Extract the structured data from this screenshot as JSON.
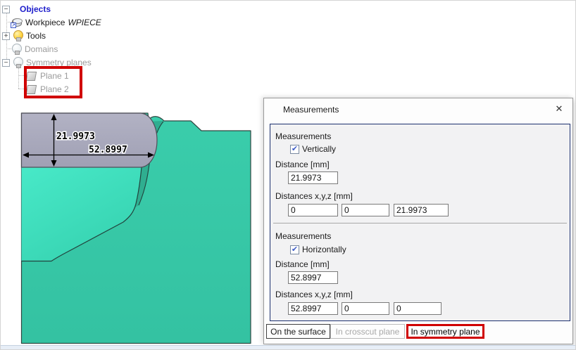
{
  "tree": {
    "expanded_glyph": "−",
    "collapsed_glyph": "+",
    "items": [
      {
        "label": "Objects"
      },
      {
        "label": "Workpiece",
        "name": "WPIECE"
      },
      {
        "label": "Tools"
      },
      {
        "label": "Domains"
      },
      {
        "label": "Symmetry planes"
      },
      {
        "label": "Plane 1"
      },
      {
        "label": "Plane 2"
      }
    ]
  },
  "viewport": {
    "vertical_distance": "21.9973",
    "horizontal_distance": "52.8997"
  },
  "dialog": {
    "title": "Measurements",
    "close_glyph": "✕",
    "sections": [
      {
        "heading": "Measurements",
        "checkbox_label": "Vertically",
        "checkbox_checked": true,
        "distance_label": "Distance [mm]",
        "distance_value": "21.9973",
        "distances_label": "Distances x,y,z [mm]",
        "distances_values": [
          "0",
          "0",
          "21.9973"
        ]
      },
      {
        "heading": "Measurements",
        "checkbox_label": "Horizontally",
        "checkbox_checked": true,
        "distance_label": "Distance [mm]",
        "distance_value": "52.8997",
        "distances_label": "Distances x,y,z [mm]",
        "distances_values": [
          "52.8997",
          "0",
          "0"
        ]
      }
    ],
    "tabs": [
      {
        "label": "On the surface",
        "state": "enabled"
      },
      {
        "label": "In crosscut plane",
        "state": "disabled"
      },
      {
        "label": "In symmetry plane",
        "state": "active-highlighted"
      }
    ]
  },
  "icons": {
    "check": "✔"
  },
  "colors": {
    "workpiece_main": "#36c5a5",
    "workpiece_pocket_light": "#44e5c3",
    "tool_gray": "#a8a8bc",
    "annotation_red": "#d00000",
    "groupbox_border": "#1b2f6e",
    "tree_root_blue": "#2020cc",
    "tree_disabled_gray": "#9b9b9b"
  }
}
